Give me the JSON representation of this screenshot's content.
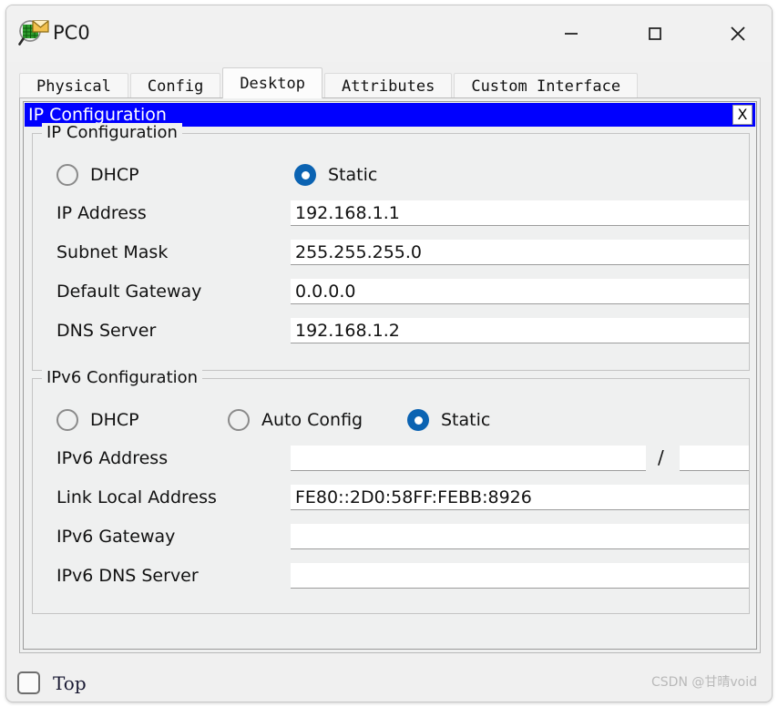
{
  "window": {
    "title": "PC0",
    "icon": "pc-device-icon",
    "controls": {
      "minimize": "─",
      "maximize": "□",
      "close": "✕"
    }
  },
  "tabs": [
    {
      "label": "Physical",
      "active": false
    },
    {
      "label": "Config",
      "active": false
    },
    {
      "label": "Desktop",
      "active": true
    },
    {
      "label": "Attributes",
      "active": false
    },
    {
      "label": "Custom Interface",
      "active": false
    }
  ],
  "dialog": {
    "title": "IP Configuration",
    "close_label": "X"
  },
  "ipv4": {
    "group_title": "IP Configuration",
    "modes": [
      {
        "label": "DHCP",
        "selected": false
      },
      {
        "label": "Static",
        "selected": true
      }
    ],
    "fields": [
      {
        "label": "IP Address",
        "value": "192.168.1.1",
        "placeholder": ""
      },
      {
        "label": "Subnet Mask",
        "value": "255.255.255.0",
        "placeholder": ""
      },
      {
        "label": "Default Gateway",
        "value": "0.0.0.0",
        "placeholder": ""
      },
      {
        "label": "DNS Server",
        "value": "192.168.1.2",
        "placeholder": ""
      }
    ]
  },
  "ipv6": {
    "group_title": "IPv6 Configuration",
    "modes": [
      {
        "label": "DHCP",
        "selected": false
      },
      {
        "label": "Auto Config",
        "selected": false
      },
      {
        "label": "Static",
        "selected": true
      }
    ],
    "address_label": "IPv6 Address",
    "address_value": "",
    "prefix_separator": "/",
    "prefix_value": "",
    "fields": [
      {
        "label": "Link Local Address",
        "value": "FE80::2D0:58FF:FEBB:8926",
        "placeholder": ""
      },
      {
        "label": "IPv6 Gateway",
        "value": "",
        "placeholder": ""
      },
      {
        "label": "IPv6 DNS Server",
        "value": "",
        "placeholder": ""
      }
    ]
  },
  "footer": {
    "top_checkbox_label": "Top",
    "top_checked": false,
    "watermark": "CSDN @甘晴void"
  },
  "colors": {
    "dialog_titlebar": "#0000ff",
    "radio_selected": "#0b63b2",
    "window_bg": "#f0f0f0",
    "panel_bg": "#eff0f0",
    "input_bg": "#ffffff"
  }
}
